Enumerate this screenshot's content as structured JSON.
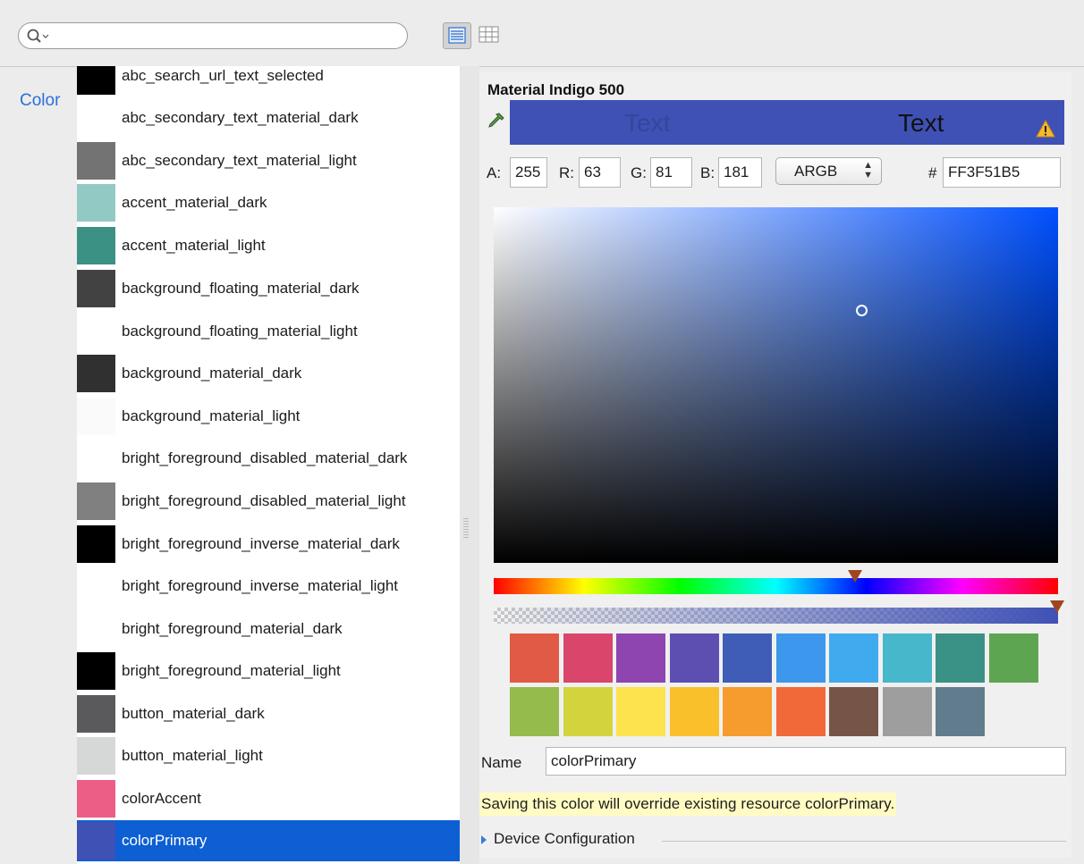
{
  "search": {
    "value": "",
    "placeholder": ""
  },
  "category": {
    "label": "Color"
  },
  "colors": [
    {
      "name": "abc_search_url_text_selected",
      "swatch": "#000000"
    },
    {
      "name": "abc_secondary_text_material_dark",
      "swatch": "#ffffff"
    },
    {
      "name": "abc_secondary_text_material_light",
      "swatch": "#737373"
    },
    {
      "name": "accent_material_dark",
      "swatch": "#92c9c4"
    },
    {
      "name": "accent_material_light",
      "swatch": "#3a9184"
    },
    {
      "name": "background_floating_material_dark",
      "swatch": "#424242"
    },
    {
      "name": "background_floating_material_light",
      "swatch": "#ffffff"
    },
    {
      "name": "background_material_dark",
      "swatch": "#303030"
    },
    {
      "name": "background_material_light",
      "swatch": "#fafafa"
    },
    {
      "name": "bright_foreground_disabled_material_dark",
      "swatch": "#ffffff"
    },
    {
      "name": "bright_foreground_disabled_material_light",
      "swatch": "#808080"
    },
    {
      "name": "bright_foreground_inverse_material_dark",
      "swatch": "#000000"
    },
    {
      "name": "bright_foreground_inverse_material_light",
      "swatch": "#ffffff"
    },
    {
      "name": "bright_foreground_material_dark",
      "swatch": "#ffffff"
    },
    {
      "name": "bright_foreground_material_light",
      "swatch": "#000000"
    },
    {
      "name": "button_material_dark",
      "swatch": "#5a595b"
    },
    {
      "name": "button_material_light",
      "swatch": "#d6d7d7"
    },
    {
      "name": "colorAccent",
      "swatch": "#ec5e86"
    },
    {
      "name": "colorPrimary",
      "swatch": "#3f51b5",
      "selected": true
    }
  ],
  "editor": {
    "title": "Material Indigo 500",
    "preview_color": "#3f51b5",
    "preview_text_dark": "Text",
    "preview_text_light": "Text",
    "a_label": "A:",
    "a_value": "255",
    "r_label": "R:",
    "r_value": "63",
    "g_label": "G:",
    "g_value": "81",
    "b_label": "B:",
    "b_value": "181",
    "format": "ARGB",
    "hash_label": "#",
    "hex_value": "FF3F51B5",
    "hue_position": 0.643,
    "alpha_position": 1.0,
    "palette": [
      "#e05a45",
      "#d9456b",
      "#8e45b0",
      "#5d4fb2",
      "#3f5db6",
      "#3d97ec",
      "#3fabee",
      "#47b7cb",
      "#3a9185",
      "#5ea551",
      "#95bb4d",
      "#d3d43d",
      "#fde34e",
      "#fac02c",
      "#f69c2e",
      "#f16839",
      "#765548",
      "#9e9e9e",
      "#617c8c"
    ],
    "name_label": "Name",
    "name_value": "colorPrimary",
    "warning": "Saving this color will override existing resource colorPrimary.",
    "device_config": "Device Configuration"
  }
}
